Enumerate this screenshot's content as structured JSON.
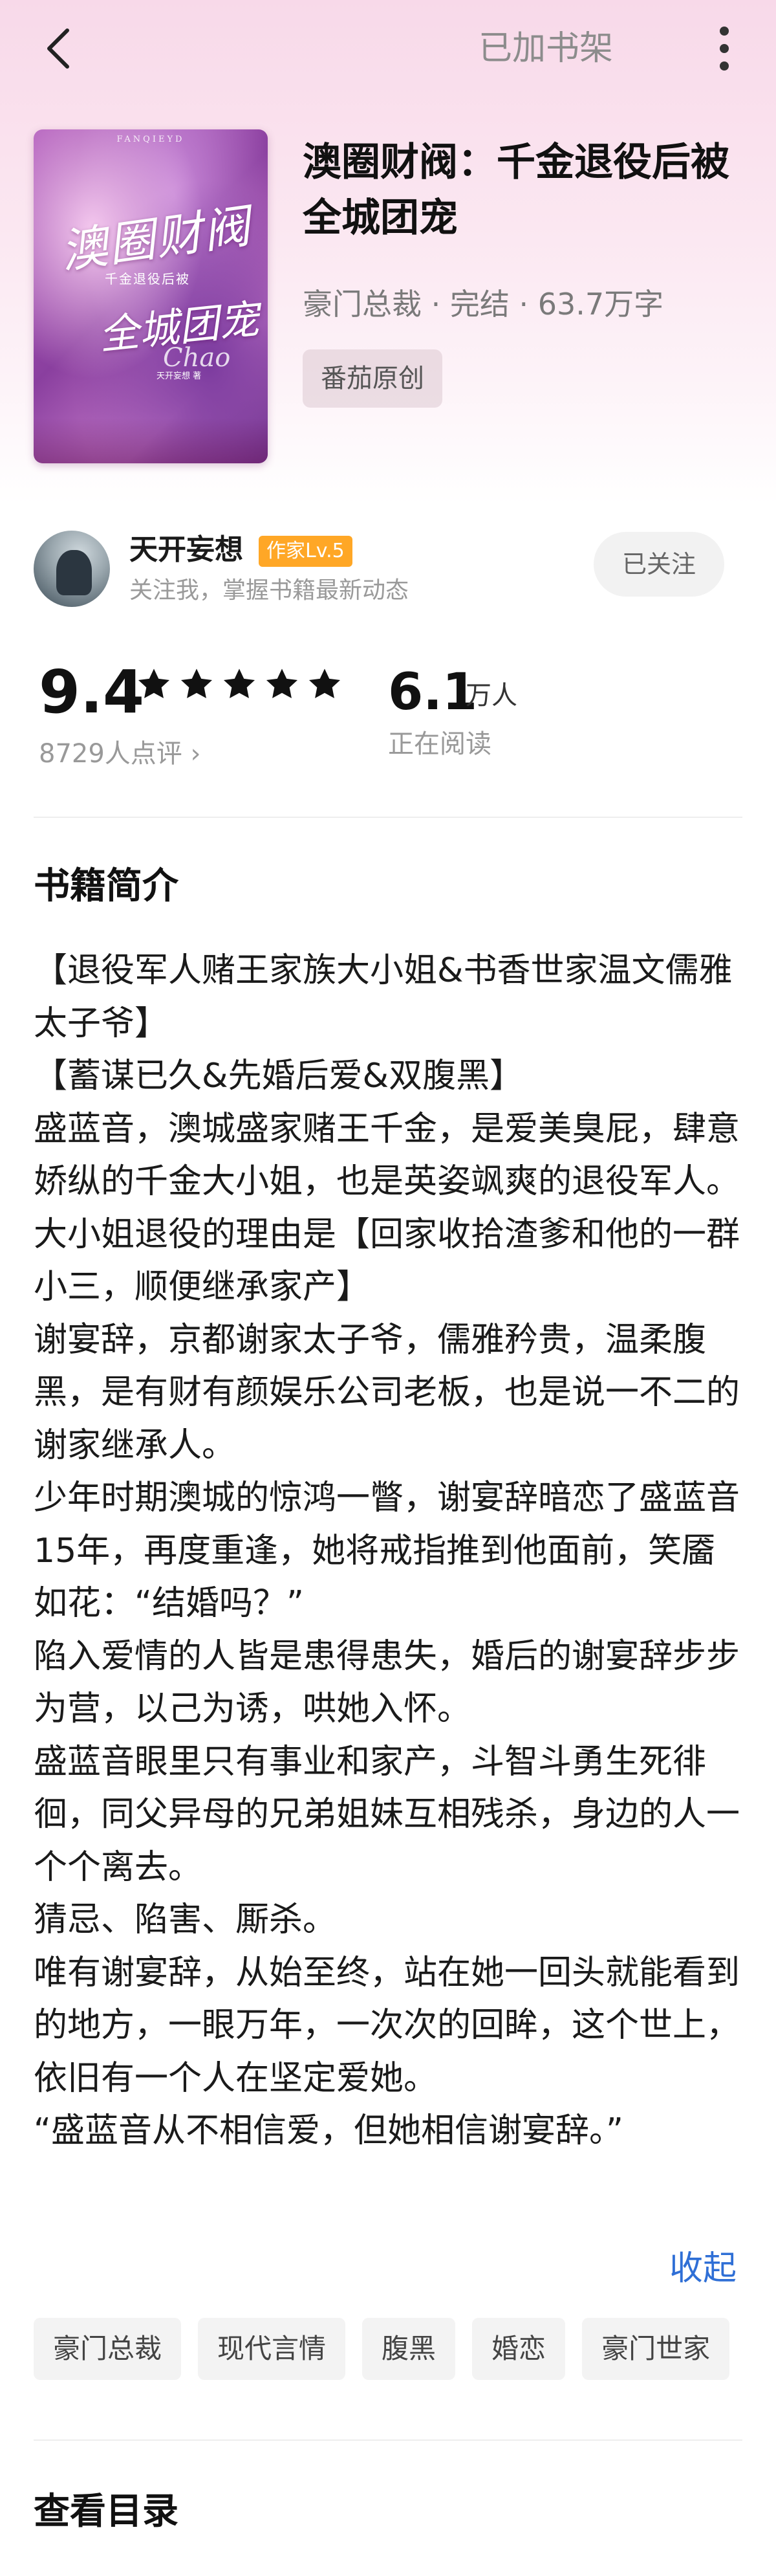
{
  "header": {
    "shelf_status": "已加书架"
  },
  "cover": {
    "brand": "FANQIEYD",
    "title_line1": "澳圈财阀",
    "subtitle": "千金退役后被",
    "title_line2": "全城团宠",
    "deco": "Chao",
    "author": "天开妄想 著"
  },
  "book": {
    "title": "澳圈财阀：千金退役后被全城团宠",
    "meta": "豪门总裁 · 完结 · 63.7万字",
    "origin_tag": "番茄原创"
  },
  "author": {
    "name": "天开妄想",
    "badge": "作家Lv.5",
    "subtitle": "关注我，掌握书籍最新动态",
    "follow_label": "已关注"
  },
  "stats": {
    "score": "9.4",
    "stars": 5,
    "review_count": "8729人点评 ›",
    "readers": "6.1",
    "readers_unit": "万人",
    "readers_sub": "正在阅读"
  },
  "intro": {
    "section_title": "书籍简介",
    "text": "【退役军人赌王家族大小姐&书香世家温文儒雅太子爷】\n【蓄谋已久&先婚后爱&双腹黑】\n盛蓝音，澳城盛家赌王千金，是爱美臭屁，肆意娇纵的千金大小姐，也是英姿飒爽的退役军人。\n大小姐退役的理由是【回家收拾渣爹和他的一群小三，顺便继承家产】\n谢宴辞，京都谢家太子爷，儒雅矜贵，温柔腹黑，是有财有颜娱乐公司老板，也是说一不二的谢家继承人。\n少年时期澳城的惊鸿一瞥，谢宴辞暗恋了盛蓝音15年，再度重逢，她将戒指推到他面前，笑靥如花：“结婚吗？”\n陷入爱情的人皆是患得患失，婚后的谢宴辞步步为营，以己为诱，哄她入怀。\n盛蓝音眼里只有事业和家产，斗智斗勇生死徘徊，同父异母的兄弟姐妹互相残杀，身边的人一个个离去。\n猜忌、陷害、厮杀。\n唯有谢宴辞，从始至终，站在她一回头就能看到的地方，一眼万年，一次次的回眸，这个世上，依旧有一个人在坚定爱她。\n“盛蓝音从不相信爱，但她相信谢宴辞。”",
    "collapse_label": "收起"
  },
  "tags": [
    "豪门总裁",
    "现代言情",
    "腹黑",
    "婚恋",
    "豪门世家"
  ],
  "catalog": {
    "section_title": "查看目录"
  },
  "colors": {
    "accent_link": "#2f6fd6",
    "badge": "#ffa726",
    "header_gradient_top": "#f8d9e9"
  }
}
